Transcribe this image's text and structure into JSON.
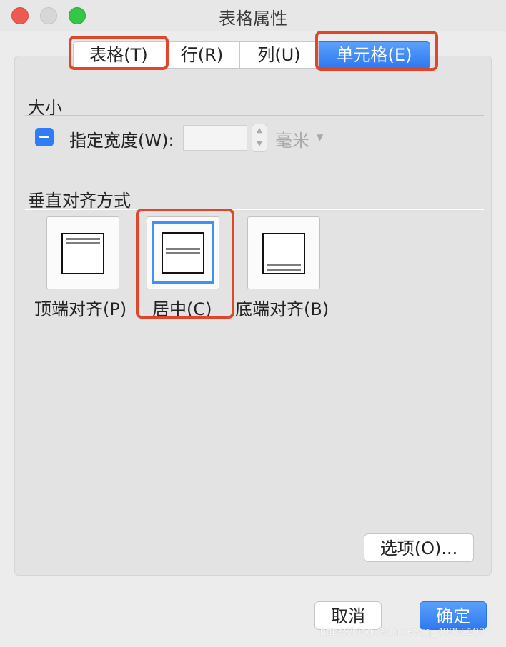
{
  "window": {
    "title": "表格属性"
  },
  "tabs": [
    {
      "label": "表格(T)"
    },
    {
      "label": "行(R)"
    },
    {
      "label": "列(U)"
    },
    {
      "label": "单元格(E)",
      "selected": true
    }
  ],
  "size_section": {
    "title": "大小",
    "width_checkbox_label": "指定宽度(W):",
    "width_value": "",
    "unit": "毫米"
  },
  "valign_section": {
    "title": "垂直对齐方式",
    "options": [
      {
        "label": "顶端对齐(P)",
        "icon": "align-top-icon"
      },
      {
        "label": "居中(C)",
        "icon": "align-center-icon",
        "selected": true
      },
      {
        "label": "底端对齐(B)",
        "icon": "align-bottom-icon"
      }
    ]
  },
  "buttons": {
    "options": "选项(O)...",
    "cancel": "取消",
    "ok": "确定"
  },
  "watermark": "https://blog.csdn.net/qq_40855100",
  "colors": {
    "accent": "#2f79f0",
    "highlight": "#e0462a",
    "selection_ring": "#3c93f5"
  }
}
